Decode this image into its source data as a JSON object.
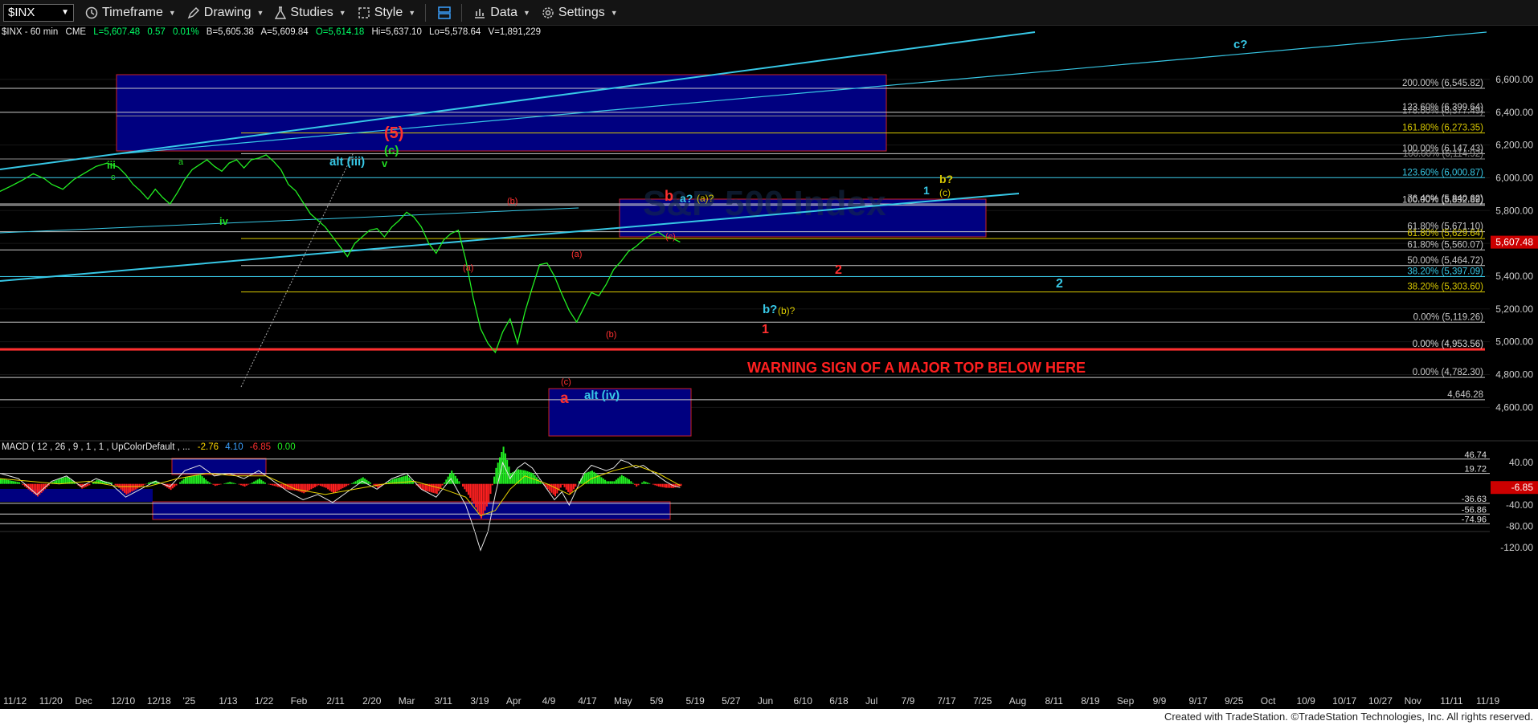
{
  "toolbar": {
    "symbol": "$INX",
    "timeframe": "Timeframe",
    "drawing": "Drawing",
    "studies": "Studies",
    "style": "Style",
    "data": "Data",
    "settings": "Settings"
  },
  "chart_data": {
    "type": "line",
    "status_line": {
      "symbol": "$INX - 60 min",
      "exchange": "CME",
      "last": "L=5,607.48",
      "change": "0.57",
      "change_pct": "0.01%",
      "bid": "B=5,605.38",
      "ask": "A=5,609.84",
      "open": "O=5,614.18",
      "high": "Hi=5,637.10",
      "low": "Lo=5,578.64",
      "volume": "V=1,891,229"
    },
    "price_axis": {
      "ylim": [
        4440,
        6820
      ],
      "ticks": [
        "6,600.00",
        "6,400.00",
        "6,200.00",
        "6,000.00",
        "5,800.00",
        "5,600.00",
        "5,400.00",
        "5,200.00",
        "5,000.00",
        "4,800.00",
        "4,600.00"
      ],
      "tick_values": [
        6600,
        6400,
        6200,
        6000,
        5800,
        5600,
        5400,
        5200,
        5000,
        4800,
        4600
      ],
      "last_price": 5607.48,
      "last_price_label": "5,607.48",
      "colors": {
        "up": "#00ff00",
        "down": "#ff0000",
        "last": "#cc0000",
        "trend": "#37c8e6",
        "box": "#000080"
      }
    },
    "x_axis_labels": [
      "11/12",
      "11/20",
      "Dec",
      "12/10",
      "12/18",
      "'25",
      "1/13",
      "1/22",
      "Feb",
      "2/11",
      "2/20",
      "Mar",
      "3/11",
      "3/19",
      "Apr",
      "4/9",
      "4/17",
      "May",
      "5/9",
      "5/19",
      "5/27",
      "Jun",
      "6/10",
      "6/18",
      "Jul",
      "7/9",
      "7/17",
      "7/25",
      "Aug",
      "8/11",
      "8/19",
      "Sep",
      "9/9",
      "9/17",
      "9/25",
      "Oct",
      "10/9",
      "10/17",
      "10/27",
      "Nov",
      "11/11",
      "11/19"
    ],
    "price_series": [
      [
        0,
        5917
      ],
      [
        3,
        5950
      ],
      [
        6,
        5985
      ],
      [
        9,
        6025
      ],
      [
        12,
        5995
      ],
      [
        14,
        5960
      ],
      [
        17,
        5930
      ],
      [
        20,
        5990
      ],
      [
        23,
        6030
      ],
      [
        26,
        6070
      ],
      [
        29,
        6090
      ],
      [
        32,
        6065
      ],
      [
        34,
        6020
      ],
      [
        36,
        5960
      ],
      [
        38,
        5920
      ],
      [
        40,
        5870
      ],
      [
        42,
        5930
      ],
      [
        44,
        5880
      ],
      [
        46,
        5840
      ],
      [
        48,
        5910
      ],
      [
        50,
        5990
      ],
      [
        52,
        6050
      ],
      [
        54,
        6080
      ],
      [
        56,
        6110
      ],
      [
        58,
        6070
      ],
      [
        60,
        6040
      ],
      [
        62,
        6090
      ],
      [
        64,
        6110
      ],
      [
        66,
        6060
      ],
      [
        68,
        6110
      ],
      [
        70,
        6120
      ],
      [
        72,
        6140
      ],
      [
        74,
        6100
      ],
      [
        76,
        6050
      ],
      [
        78,
        5960
      ],
      [
        80,
        5920
      ],
      [
        82,
        5850
      ],
      [
        84,
        5780
      ],
      [
        86,
        5740
      ],
      [
        88,
        5700
      ],
      [
        90,
        5640
      ],
      [
        92,
        5580
      ],
      [
        94,
        5520
      ],
      [
        96,
        5600
      ],
      [
        98,
        5640
      ],
      [
        100,
        5680
      ],
      [
        102,
        5690
      ],
      [
        104,
        5640
      ],
      [
        106,
        5700
      ],
      [
        108,
        5740
      ],
      [
        110,
        5790
      ],
      [
        112,
        5760
      ],
      [
        114,
        5700
      ],
      [
        116,
        5600
      ],
      [
        118,
        5540
      ],
      [
        120,
        5620
      ],
      [
        122,
        5660
      ],
      [
        124,
        5680
      ],
      [
        126,
        5500
      ],
      [
        128,
        5270
      ],
      [
        130,
        5080
      ],
      [
        132,
        4990
      ],
      [
        134,
        4935
      ],
      [
        136,
        5060
      ],
      [
        138,
        5140
      ],
      [
        140,
        4990
      ],
      [
        142,
        5180
      ],
      [
        144,
        5330
      ],
      [
        146,
        5470
      ],
      [
        148,
        5480
      ],
      [
        150,
        5400
      ],
      [
        152,
        5290
      ],
      [
        154,
        5190
      ],
      [
        156,
        5120
      ],
      [
        158,
        5210
      ],
      [
        160,
        5300
      ],
      [
        162,
        5280
      ],
      [
        164,
        5350
      ],
      [
        166,
        5440
      ],
      [
        168,
        5490
      ],
      [
        170,
        5550
      ],
      [
        172,
        5580
      ],
      [
        174,
        5620
      ],
      [
        176,
        5650
      ],
      [
        178,
        5670
      ],
      [
        180,
        5640
      ],
      [
        182,
        5630
      ],
      [
        184,
        5608
      ]
    ],
    "horizontal_levels": [
      {
        "label": "200.00% (6,545.82)",
        "value": 6545.82,
        "color": "#c8c8c8"
      },
      {
        "label": "178.60% (6,377.49)",
        "value": 6377.49,
        "color": "#8f8f8f"
      },
      {
        "label": "123.60% (6,399.64)",
        "value": 6399.64,
        "color": "#c8c8c8"
      },
      {
        "label": "161.80% (6,273.35)",
        "value": 6273.35,
        "color": "#d8c800"
      },
      {
        "label": "100.00% (6,147.43)",
        "value": 6147.43,
        "color": "#c8c8c8"
      },
      {
        "label": "100.00% (6,114.92)",
        "value": 6114.92,
        "color": "#8f8f8f"
      },
      {
        "label": "123.60% (6,000.87)",
        "value": 6000.87,
        "color": "#37c8e6"
      },
      {
        "label": "76.40% (5,840.62)",
        "value": 5840.62,
        "color": "#c8c8c8"
      },
      {
        "label": "100.00% (5,832.89)",
        "value": 5832.89,
        "color": "#c8c8c8"
      },
      {
        "label": "61.80% (5,671.10)",
        "value": 5671.1,
        "color": "#c8c8c8"
      },
      {
        "label": "61.80% (5,629.64)",
        "value": 5629.64,
        "color": "#d8c800"
      },
      {
        "label": "61.80% (5,560.07)",
        "value": 5560.07,
        "color": "#c8c8c8"
      },
      {
        "label": "50.00% (5,464.72)",
        "value": 5464.72,
        "color": "#c8c8c8"
      },
      {
        "label": "38.20% (5,397.09)",
        "value": 5397.09,
        "color": "#37c8e6"
      },
      {
        "label": "38.20% (5,303.60)",
        "value": 5303.6,
        "color": "#d8c800"
      },
      {
        "label": "0.00% (5,119.26)",
        "value": 5119.26,
        "color": "#c8c8c8"
      },
      {
        "label": "0.00% (4,953.56)",
        "value": 4953.56,
        "color": "#ff3030"
      },
      {
        "label": "0.00% (4,782.30)",
        "value": 4782.3,
        "color": "#c8c8c8"
      },
      {
        "label": "4,646.28",
        "value": 4646.28,
        "color": "#c8c8c8"
      }
    ],
    "annotations": [
      {
        "text": "(5)",
        "color": "#ff3030"
      },
      {
        "text": "(c)",
        "color": "#22dd22"
      },
      {
        "text": "v",
        "color": "#22dd22"
      },
      {
        "text": "alt (iii)",
        "color": "#37c8e6"
      },
      {
        "text": "iii",
        "color": "#22dd22"
      },
      {
        "text": "c",
        "color": "#22dd22"
      },
      {
        "text": "iv",
        "color": "#22dd22"
      },
      {
        "text": "a",
        "color": "#22dd22"
      },
      {
        "text": "(a)",
        "color": "#ff3030"
      },
      {
        "text": "(b)",
        "color": "#ff3030"
      },
      {
        "text": "(a)",
        "color": "#ff3030"
      },
      {
        "text": "(b)",
        "color": "#ff3030"
      },
      {
        "text": "(c)",
        "color": "#ff3030"
      },
      {
        "text": "(c)",
        "color": "#ff3030"
      },
      {
        "text": "a",
        "color": "#ff3030"
      },
      {
        "text": "alt (iv)",
        "color": "#37c8e6"
      },
      {
        "text": "b",
        "color": "#ff3030"
      },
      {
        "text": "a?",
        "color": "#37c8e6"
      },
      {
        "text": "(a)?",
        "color": "#d8c800"
      },
      {
        "text": "b?",
        "color": "#37c8e6"
      },
      {
        "text": "(b)?",
        "color": "#d8c800"
      },
      {
        "text": "1",
        "color": "#ff3030"
      },
      {
        "text": "2",
        "color": "#ff3030"
      },
      {
        "text": "1",
        "color": "#37c8e6"
      },
      {
        "text": "b?",
        "color": "#d8c800"
      },
      {
        "text": "(c)",
        "color": "#d8c800"
      },
      {
        "text": "2",
        "color": "#37c8e6"
      },
      {
        "text": "c?",
        "color": "#37c8e6"
      }
    ],
    "warning": "WARNING SIGN OF A MAJOR TOP BELOW HERE",
    "watermark": "S&P 500 Index",
    "macd": {
      "label": "MACD ( 12 , 26 , 9 , 1 , 1 , UpColorDefault , ...",
      "value1": "-2.76",
      "value2": "4.10",
      "value3": "-6.85",
      "value4": "0.00",
      "ticks": [
        "40.00",
        "-40.00",
        "-80.00",
        "-120.00"
      ],
      "tick_values": [
        40,
        -40,
        -80,
        -120
      ],
      "ylim": [
        -135,
        60
      ],
      "levels": [
        {
          "label": "46.74",
          "value": 46.74
        },
        {
          "label": "19.72",
          "value": 19.72
        },
        {
          "label": "-36.63",
          "value": -36.63
        },
        {
          "label": "-56.86",
          "value": -56.86
        },
        {
          "label": "-74.96",
          "value": -74.96
        }
      ],
      "current_label": "-6.85",
      "current_value": -6.85,
      "macd_line": [
        [
          0,
          20
        ],
        [
          5,
          10
        ],
        [
          10,
          -20
        ],
        [
          14,
          5
        ],
        [
          18,
          15
        ],
        [
          22,
          -5
        ],
        [
          26,
          10
        ],
        [
          30,
          0
        ],
        [
          34,
          -25
        ],
        [
          38,
          -10
        ],
        [
          42,
          5
        ],
        [
          46,
          -5
        ],
        [
          50,
          25
        ],
        [
          54,
          35
        ],
        [
          58,
          15
        ],
        [
          62,
          20
        ],
        [
          66,
          10
        ],
        [
          70,
          25
        ],
        [
          74,
          5
        ],
        [
          78,
          -15
        ],
        [
          82,
          -30
        ],
        [
          86,
          -20
        ],
        [
          90,
          -35
        ],
        [
          94,
          -15
        ],
        [
          98,
          5
        ],
        [
          102,
          -10
        ],
        [
          106,
          10
        ],
        [
          110,
          20
        ],
        [
          114,
          -10
        ],
        [
          118,
          -25
        ],
        [
          122,
          10
        ],
        [
          126,
          -40
        ],
        [
          128,
          -80
        ],
        [
          130,
          -125
        ],
        [
          132,
          -90
        ],
        [
          134,
          -20
        ],
        [
          136,
          40
        ],
        [
          138,
          10
        ],
        [
          140,
          30
        ],
        [
          142,
          40
        ],
        [
          144,
          30
        ],
        [
          146,
          10
        ],
        [
          148,
          -10
        ],
        [
          150,
          -30
        ],
        [
          152,
          -15
        ],
        [
          154,
          -40
        ],
        [
          156,
          -10
        ],
        [
          158,
          20
        ],
        [
          160,
          35
        ],
        [
          162,
          30
        ],
        [
          164,
          25
        ],
        [
          166,
          30
        ],
        [
          168,
          45
        ],
        [
          170,
          40
        ],
        [
          172,
          30
        ],
        [
          174,
          35
        ],
        [
          176,
          25
        ],
        [
          178,
          15
        ],
        [
          180,
          5
        ],
        [
          182,
          -3
        ],
        [
          184,
          -7
        ]
      ],
      "signal_line": [
        [
          0,
          10
        ],
        [
          8,
          5
        ],
        [
          16,
          0
        ],
        [
          24,
          5
        ],
        [
          32,
          -5
        ],
        [
          40,
          -5
        ],
        [
          48,
          10
        ],
        [
          56,
          20
        ],
        [
          64,
          15
        ],
        [
          72,
          15
        ],
        [
          80,
          -10
        ],
        [
          88,
          -20
        ],
        [
          96,
          -10
        ],
        [
          104,
          0
        ],
        [
          112,
          5
        ],
        [
          120,
          -10
        ],
        [
          126,
          -25
        ],
        [
          130,
          -60
        ],
        [
          134,
          -50
        ],
        [
          138,
          -10
        ],
        [
          142,
          15
        ],
        [
          148,
          0
        ],
        [
          154,
          -20
        ],
        [
          160,
          10
        ],
        [
          166,
          25
        ],
        [
          172,
          35
        ],
        [
          178,
          20
        ],
        [
          184,
          -3
        ]
      ]
    }
  },
  "footer": "Created with TradeStation. ©TradeStation Technologies, Inc. All rights reserved."
}
